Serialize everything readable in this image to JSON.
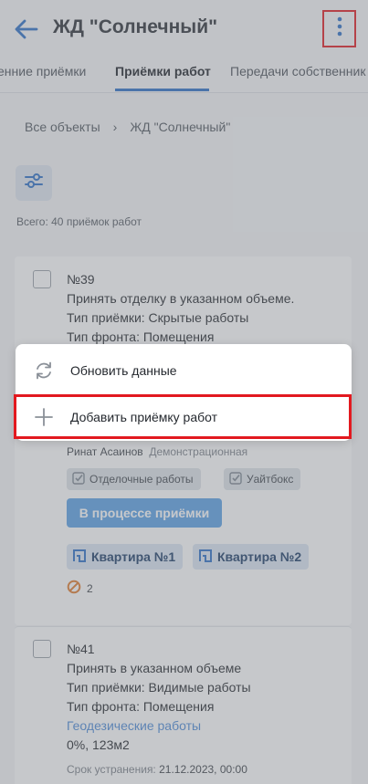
{
  "header": {
    "title": "ЖД \"Солнечный\""
  },
  "tabs": [
    {
      "label": "енние приёмки",
      "active": false
    },
    {
      "label": "Приёмки работ",
      "active": true
    },
    {
      "label": "Передачи собственник",
      "active": false
    }
  ],
  "breadcrumb": {
    "root": "Все объекты",
    "separator": "›",
    "current": "ЖД \"Солнечный\""
  },
  "total": "Всего: 40 приёмок работ",
  "card1": {
    "number": "№39",
    "line1": "Принять отделку в указанном объеме.",
    "line2": "Тип приёмки: Скрытые работы",
    "line3": "Тип фронта: Помещения",
    "author": "Ринат Асаинов",
    "org": "Демонстрационная",
    "tags": [
      "Отделочные работы",
      "Уайтбокс"
    ],
    "status": "В процессе приёмки",
    "rooms": [
      "Квартира №1",
      "Квартира №2"
    ],
    "count": "2"
  },
  "card2": {
    "number": "№41",
    "line1": "Принять в указанном объеме",
    "line2": "Тип приёмки: Видимые работы",
    "line3": "Тип фронта: Помещения",
    "work": "Геодезические работы",
    "progress": "0%, 123м2",
    "deadline_label": "Срок устранения:",
    "deadline": "21.12.2023, 00:00"
  },
  "menu": {
    "refresh": "Обновить данные",
    "add": "Добавить приёмку работ"
  },
  "colors": {
    "accent": "#2b6fc6",
    "highlight": "#e2191f",
    "status": "#5aa0e6"
  }
}
